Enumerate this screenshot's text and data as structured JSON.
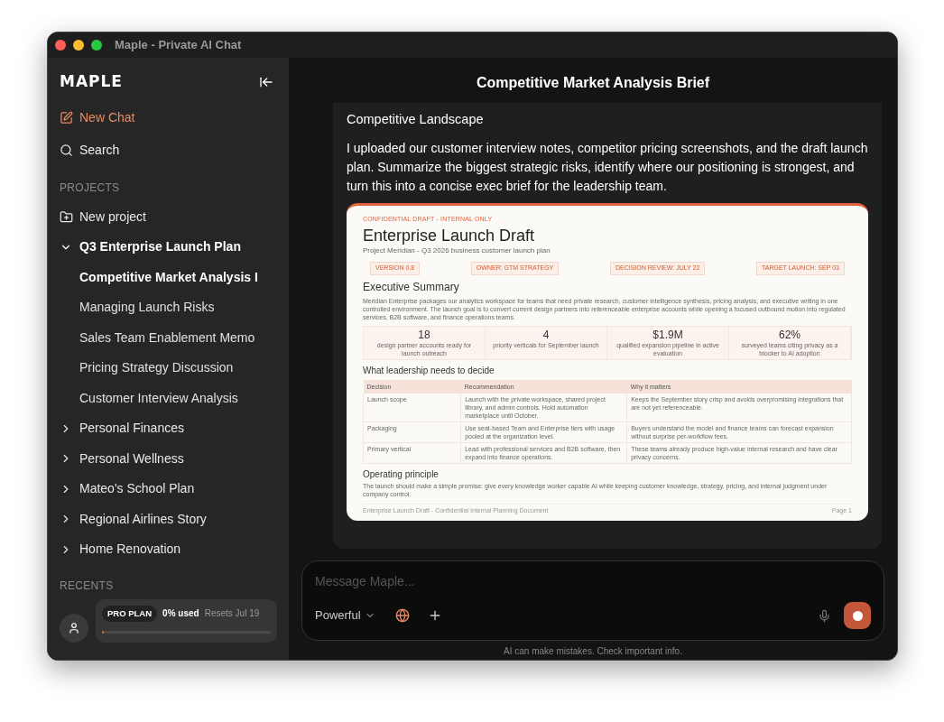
{
  "window": {
    "title": "Maple - Private AI Chat"
  },
  "sidebar": {
    "logo": "MAPLE",
    "nav": [
      {
        "kind": "new_chat",
        "label": "New Chat"
      },
      {
        "kind": "search",
        "label": "Search"
      }
    ],
    "projects_heading": "PROJECTS",
    "new_project": "New project",
    "projects": [
      {
        "label": "Q3 Enterprise Launch Plan",
        "expanded": true,
        "children": [
          {
            "label": "Competitive Market Analysis I",
            "selected": true
          },
          {
            "label": "Managing Launch Risks",
            "selected": false
          },
          {
            "label": "Sales Team Enablement Memo",
            "selected": false
          },
          {
            "label": "Pricing Strategy Discussion",
            "selected": false
          },
          {
            "label": "Customer Interview Analysis",
            "selected": false
          }
        ]
      },
      {
        "label": "Personal Finances",
        "expanded": false
      },
      {
        "label": "Personal Wellness",
        "expanded": false
      },
      {
        "label": "Mateo's School Plan",
        "expanded": false
      },
      {
        "label": "Regional Airlines Story",
        "expanded": false
      },
      {
        "label": "Home Renovation",
        "expanded": false
      }
    ],
    "recents_heading": "RECENTS",
    "plan": {
      "badge": "PRO PLAN",
      "usage": "0% used",
      "reset": "Resets Jul 19",
      "level": 0.01
    }
  },
  "chat": {
    "title": "Competitive Market Analysis Brief",
    "message": {
      "heading": "Competitive Landscape",
      "text": "I uploaded our customer interview notes, competitor pricing screenshots, and the draft launch plan. Summarize the biggest strategic risks, identify where our positioning is strongest, and turn this into a concise exec brief for the leadership team."
    },
    "document": {
      "label": "CONFIDENTIAL DRAFT - INTERNAL ONLY",
      "title": "Enterprise Launch Draft",
      "subtitle": "Project Meridian - Q3 2026 business customer launch plan",
      "tags": [
        "VERSION 0.8",
        "OWNER: GTM STRATEGY",
        "DECISION REVIEW: JULY 22",
        "TARGET LAUNCH: SEP 03"
      ],
      "summary_heading": "Executive Summary",
      "summary": "Meridian Enterprise packages our analytics workspace for teams that need private research, customer intelligence synthesis, pricing analysis, and executive writing in one controlled environment. The launch goal is to convert current design partners into referenceable enterprise accounts while opening a focused outbound motion into regulated services, B2B software, and finance operations teams.",
      "stats": [
        {
          "value": "18",
          "caption": "design partner accounts ready for launch outreach"
        },
        {
          "value": "4",
          "caption": "priority verticals for September launch"
        },
        {
          "value": "$1.9M",
          "caption": "qualified expansion pipeline in active evaluation"
        },
        {
          "value": "62%",
          "caption": "surveyed teams citing privacy as a blocker to AI adoption"
        }
      ],
      "decision_heading": "What leadership needs to decide",
      "table": {
        "columns": [
          "Decision",
          "Recommendation",
          "Why it matters"
        ],
        "rows": [
          [
            "Launch scope",
            "Launch with the private workspace, shared project library, and admin controls. Hold automation marketplace until October.",
            "Keeps the September story crisp and avoids overpromising integrations that are not yet referenceable."
          ],
          [
            "Packaging",
            "Use seat-based Team and Enterprise tiers with usage pooled at the organization level.",
            "Buyers understand the model and finance teams can forecast expansion without surprise per-workflow fees."
          ],
          [
            "Primary vertical",
            "Lead with professional services and B2B software, then expand into finance operations.",
            "These teams already produce high-value internal research and have clear privacy concerns."
          ]
        ]
      },
      "principle_heading": "Operating principle",
      "principle": "The launch should make a simple promise: give every knowledge worker capable AI while keeping customer knowledge, strategy, pricing, and internal judgment under company control.",
      "footer_left": "Enterprise Launch Draft - Confidential Internal Planning Document",
      "footer_right": "Page 1"
    },
    "composer": {
      "placeholder": "Message Maple...",
      "mode": "Powerful",
      "web_search": true
    },
    "disclaimer": "AI can make mistakes. Check important info."
  }
}
